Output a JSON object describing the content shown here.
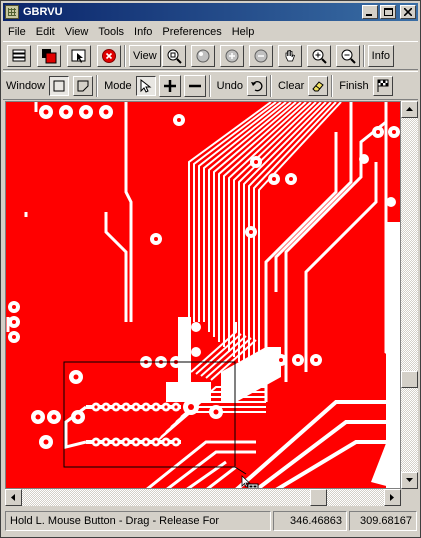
{
  "app": {
    "title": "GBRVU"
  },
  "menu": [
    "File",
    "Edit",
    "View",
    "Tools",
    "Info",
    "Preferences",
    "Help"
  ],
  "toolbar1": {
    "view_label": "View",
    "info_label": "Info"
  },
  "toolbar2": {
    "window_label": "Window",
    "mode_label": "Mode",
    "undo_label": "Undo",
    "clear_label": "Clear",
    "finish_label": "Finish"
  },
  "colors": {
    "board": "#ff0000",
    "trace": "#ffffff",
    "selection": "#000000"
  },
  "status": {
    "message": "Hold L. Mouse Button - Drag - Release For",
    "x_coord": "346.46863",
    "y_coord": "309.68167"
  }
}
